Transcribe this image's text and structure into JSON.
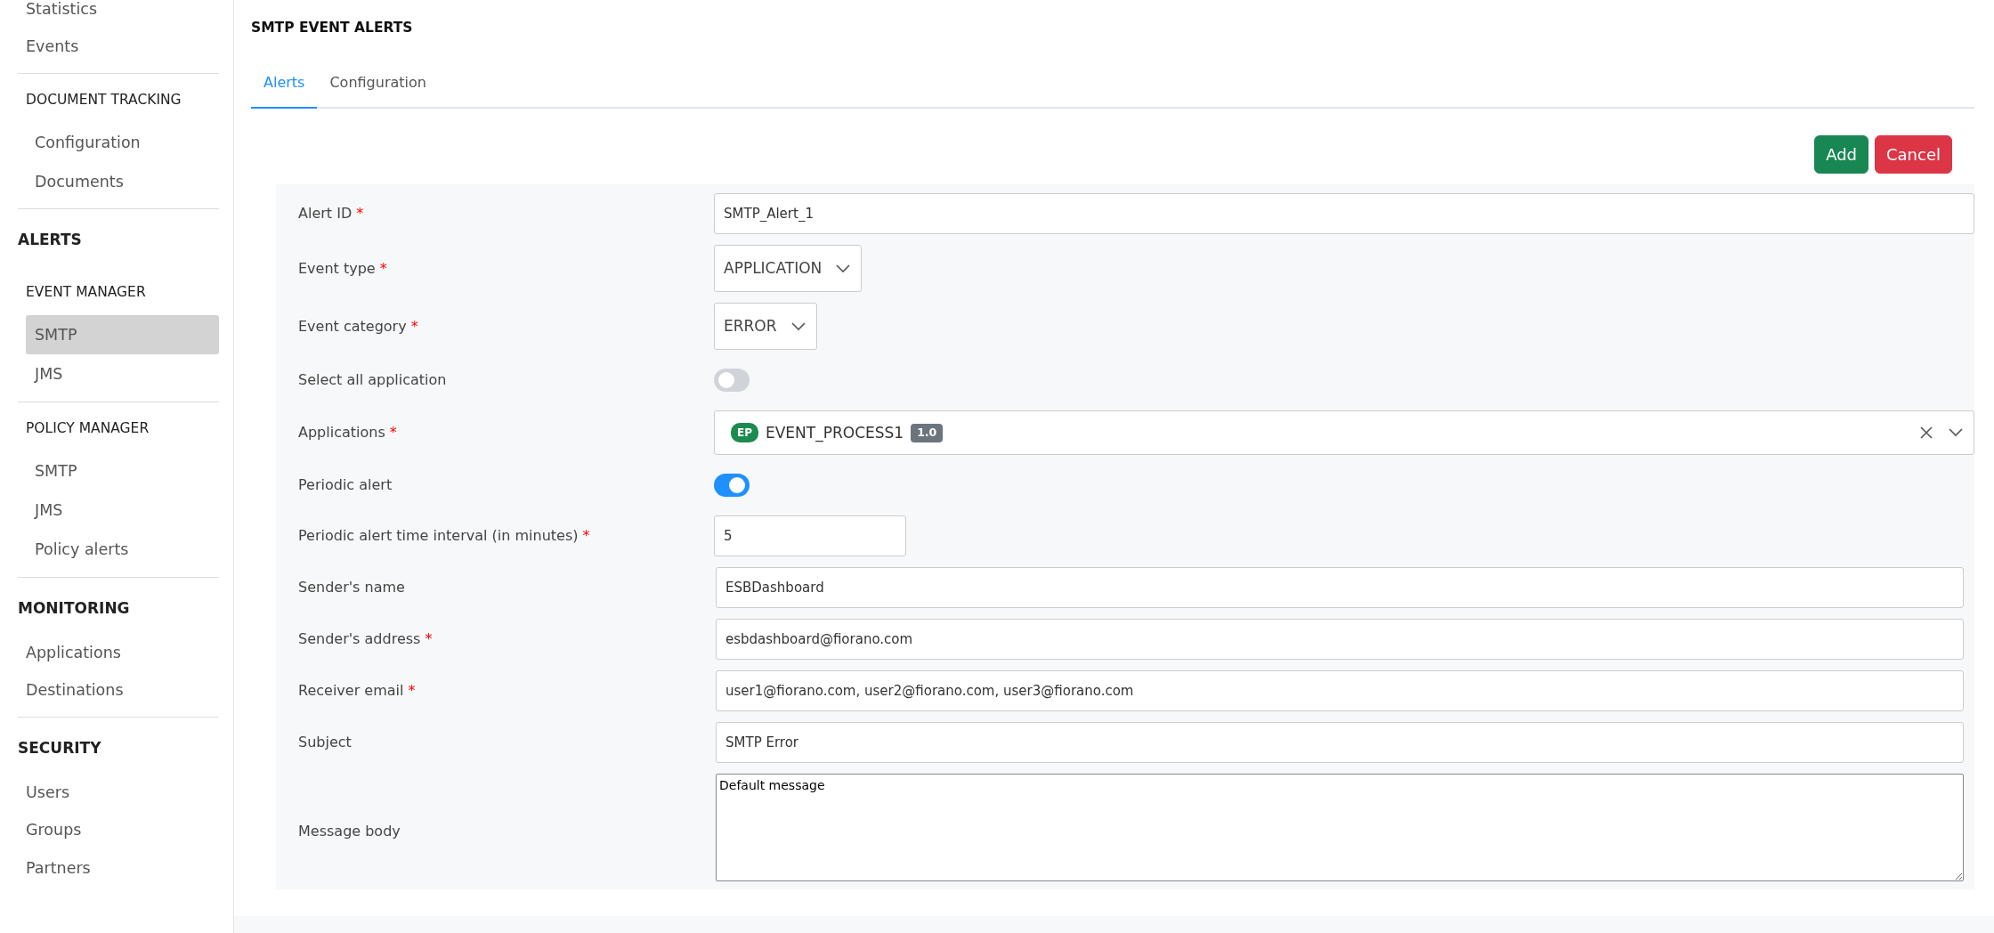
{
  "sidebar": {
    "groups": [
      {
        "entries": [
          {
            "kind": "item",
            "label": "Statistics",
            "selected": false
          },
          {
            "kind": "item",
            "label": "Events",
            "selected": false
          }
        ]
      },
      {
        "entries": [
          {
            "kind": "heading",
            "label": "DOCUMENT TRACKING"
          },
          {
            "kind": "sub",
            "label": "Configuration",
            "selected": false
          },
          {
            "kind": "sub",
            "label": "Documents",
            "selected": false
          }
        ]
      },
      {
        "entries": [
          {
            "kind": "section",
            "label": "ALERTS"
          },
          {
            "kind": "heading",
            "label": "EVENT MANAGER"
          },
          {
            "kind": "sub",
            "label": "SMTP",
            "selected": true
          },
          {
            "kind": "sub",
            "label": "JMS",
            "selected": false
          }
        ]
      },
      {
        "entries": [
          {
            "kind": "heading",
            "label": "POLICY MANAGER"
          },
          {
            "kind": "sub",
            "label": "SMTP",
            "selected": false
          },
          {
            "kind": "sub",
            "label": "JMS",
            "selected": false
          },
          {
            "kind": "sub",
            "label": "Policy alerts",
            "selected": false
          }
        ]
      },
      {
        "entries": [
          {
            "kind": "section",
            "label": "MONITORING"
          },
          {
            "kind": "item",
            "label": "Applications",
            "selected": false
          },
          {
            "kind": "item",
            "label": "Destinations",
            "selected": false
          }
        ]
      },
      {
        "entries": [
          {
            "kind": "section",
            "label": "SECURITY"
          },
          {
            "kind": "item",
            "label": "Users",
            "selected": false
          },
          {
            "kind": "item",
            "label": "Groups",
            "selected": false
          },
          {
            "kind": "item",
            "label": "Partners",
            "selected": false
          }
        ]
      }
    ]
  },
  "page": {
    "title": "SMTP EVENT ALERTS"
  },
  "tabs": [
    {
      "label": "Alerts",
      "selected": true
    },
    {
      "label": "Configuration",
      "selected": false
    }
  ],
  "buttons": [
    {
      "kind": "primary",
      "label": "Add"
    },
    {
      "kind": "danger",
      "label": "Cancel"
    }
  ],
  "form": {
    "fields": [
      {
        "kind": "text",
        "label": "Alert ID",
        "required_mark": "*",
        "value": "SMTP_Alert_1"
      },
      {
        "kind": "select",
        "label": "Event type",
        "required_mark": "*",
        "value": "APPLICATION"
      },
      {
        "kind": "select",
        "label": "Event category",
        "required_mark": "*",
        "value": "ERROR"
      },
      {
        "kind": "toggle",
        "label": "Select all application",
        "on": false
      },
      {
        "kind": "multiselect",
        "label": "Applications",
        "required_mark": "*",
        "tag": "EP",
        "value": "EVENT_PROCESS1",
        "version": "1.0"
      },
      {
        "kind": "toggle",
        "label": "Periodic alert",
        "on": true
      },
      {
        "kind": "short",
        "label": "Periodic alert time interval (in minutes)",
        "required_mark": "*",
        "value": "5"
      },
      {
        "kind": "text2",
        "label": "Sender's name",
        "value": "ESBDashboard"
      },
      {
        "kind": "text2",
        "label": "Sender's address",
        "required_mark": "*",
        "value": "esbdashboard@fiorano.com"
      },
      {
        "kind": "text2",
        "label": "Receiver email",
        "required_mark": "*",
        "value": "user1@fiorano.com, user2@fiorano.com, user3@fiorano.com"
      },
      {
        "kind": "text2",
        "label": "Subject",
        "value": "SMTP Error"
      },
      {
        "kind": "textarea",
        "label": "Message body",
        "value": "Default message"
      }
    ]
  }
}
